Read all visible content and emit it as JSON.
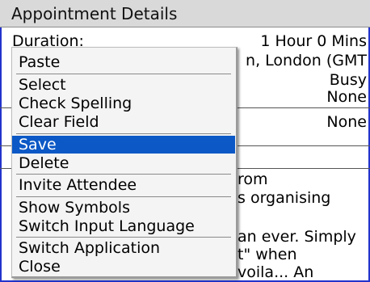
{
  "title": "Appointment Details",
  "colors": {
    "accent": "#0b58c6",
    "frame": "#2233cc",
    "title_bar": "#d9d9d9"
  },
  "form": {
    "duration_label": "Duration:",
    "duration_value": "1 Hour 0 Mins",
    "timezone_partial": "n, London (GMT",
    "busy_value": "Busy",
    "none_value_1": "None",
    "none_value_2": "None",
    "notes_line_1": "rom",
    "notes_line_2": "s organising",
    "notes_line_3": "an ever. Simply",
    "notes_line_4": "t\" when",
    "notes_line_5": "voila... An"
  },
  "context_menu": {
    "paste": "Paste",
    "select": "Select",
    "check_spelling": "Check Spelling",
    "clear_field": "Clear Field",
    "save": "Save",
    "delete": "Delete",
    "invite_attendee": "Invite Attendee",
    "show_symbols": "Show Symbols",
    "switch_input_language": "Switch Input Language",
    "switch_application": "Switch Application",
    "close": "Close",
    "selected_item": "Save"
  }
}
